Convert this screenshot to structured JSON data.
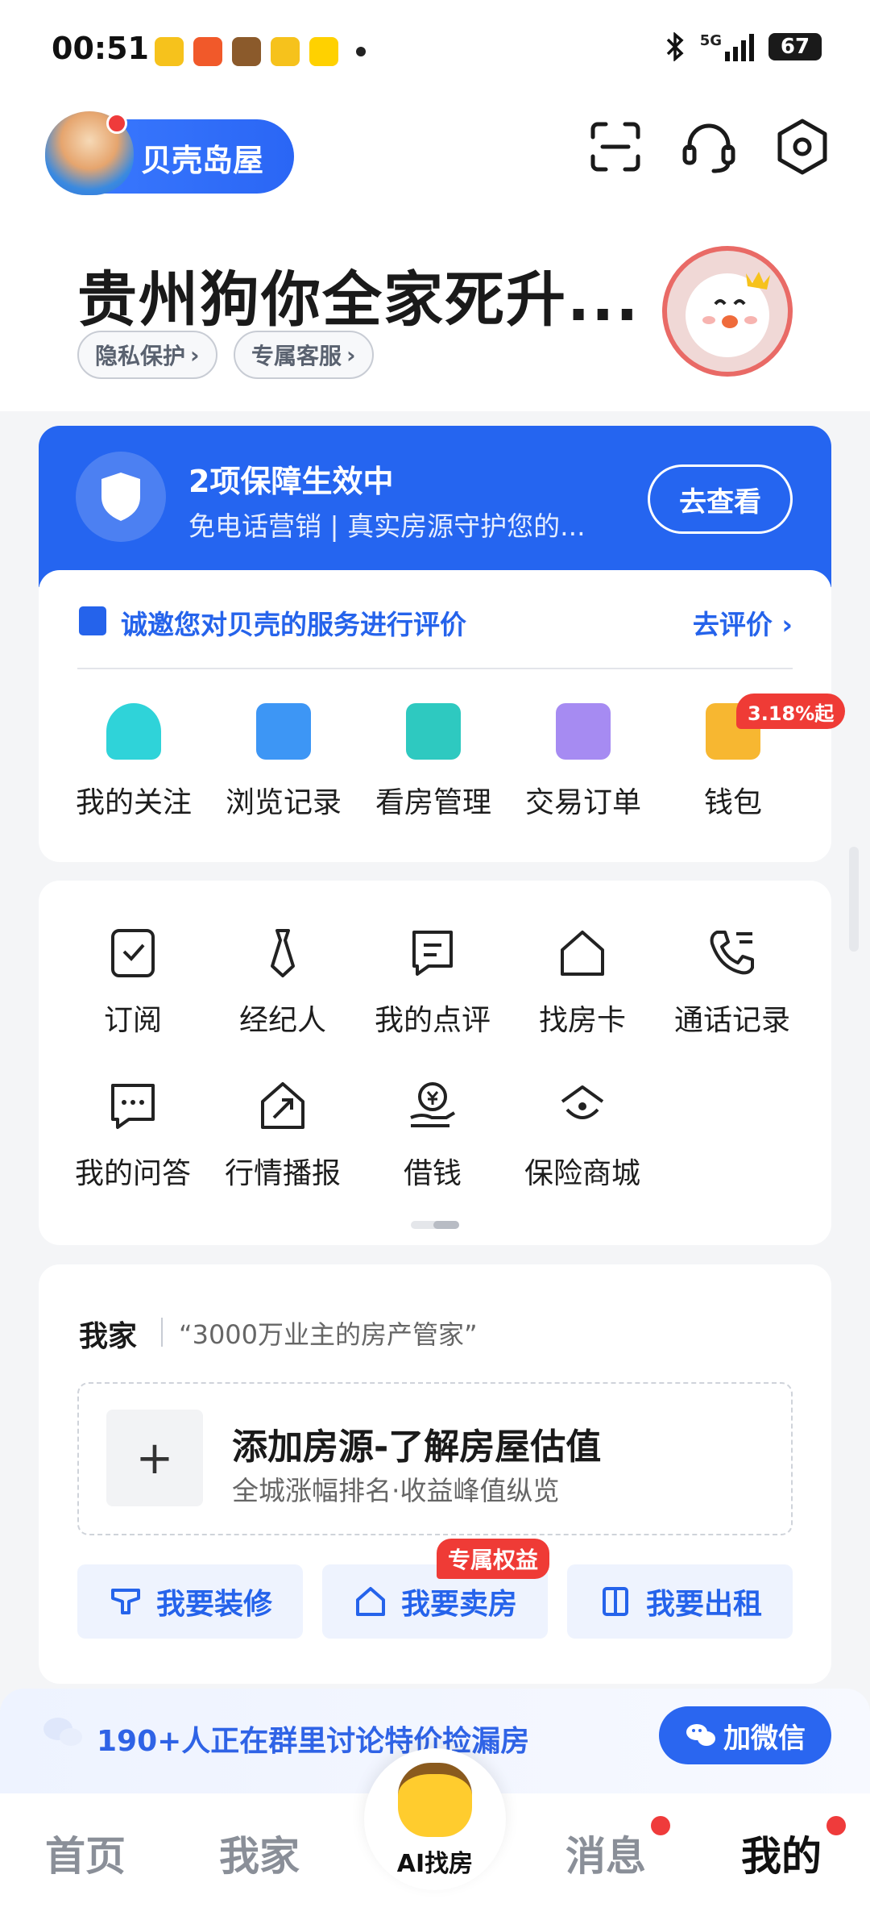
{
  "status_bar": {
    "time": "00:51",
    "network": "5G",
    "battery": "67"
  },
  "header": {
    "logo_text": "贝壳岛屋",
    "username": "贵州狗你全家死升...",
    "chips": [
      "隐私保护",
      "专属客服"
    ],
    "icons": [
      "scan-icon",
      "customer-service-icon",
      "settings-icon"
    ]
  },
  "protection": {
    "title": "2项保障生效中",
    "subtitle": "免电话营销 | 真实房源守护您的...",
    "button": "去查看"
  },
  "evaluation": {
    "text": "诚邀您对贝壳的服务进行评价",
    "link": "去评价"
  },
  "services": {
    "items": [
      "我的关注",
      "浏览记录",
      "看房管理",
      "交易订单",
      "钱包"
    ],
    "wallet_badge": "3.18%起"
  },
  "tools": {
    "row1": [
      "订阅",
      "经纪人",
      "我的点评",
      "找房卡",
      "通话记录"
    ],
    "row2": [
      "我的问答",
      "行情播报",
      "借钱",
      "保险商城"
    ]
  },
  "home": {
    "title": "我家",
    "slogan": "“3000万业主的房产管家”",
    "add_plus": "+",
    "add_title": "添加房源-了解房屋估值",
    "add_subtitle": "全城涨幅排名·收益峰值纵览",
    "buttons": [
      "我要装修",
      "我要卖房",
      "我要出租"
    ],
    "exclusive_badge": "专属权益"
  },
  "wechat_banner": {
    "text": "190+人正在群里讨论特价捡漏房",
    "button": "加微信"
  },
  "tabbar": {
    "tabs": [
      "首页",
      "我家",
      "AI找房",
      "消息",
      "我的"
    ],
    "active": "我的"
  },
  "colors": {
    "primary": "#2565f0",
    "badge_red": "#ef3b36",
    "text_blue": "#2563eb"
  }
}
